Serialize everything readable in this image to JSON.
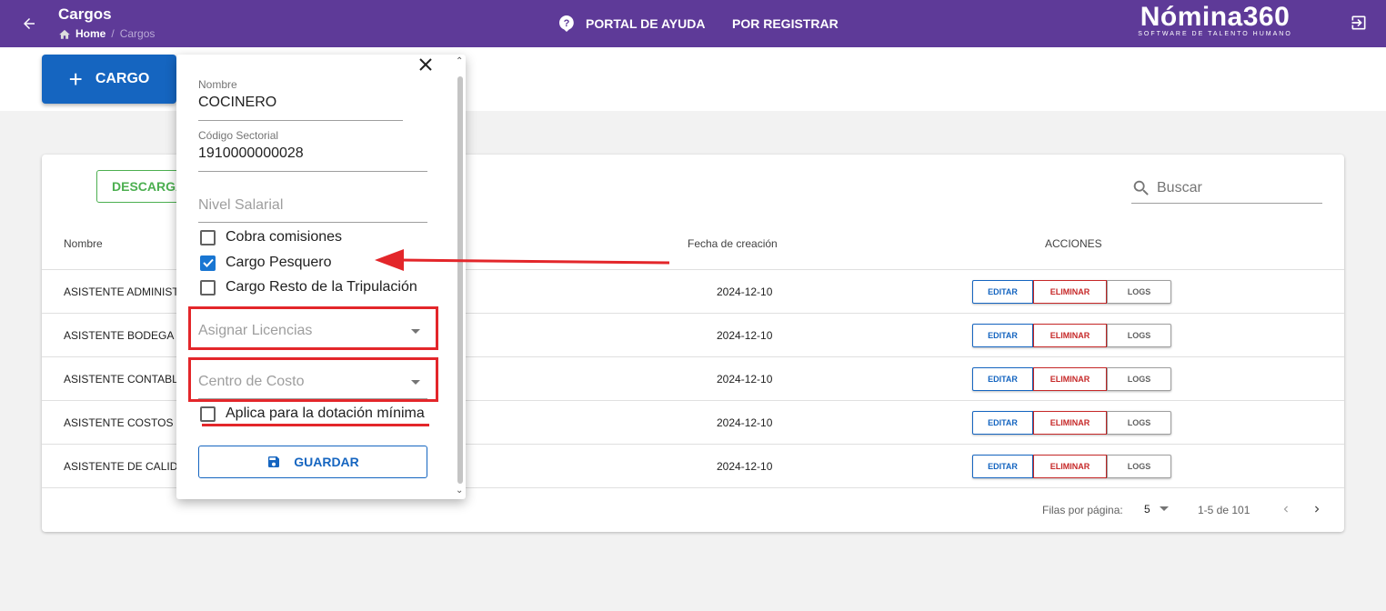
{
  "header": {
    "title": "Cargos",
    "breadcrumb": {
      "home": "Home",
      "current": "Cargos"
    },
    "help_link": "PORTAL DE AYUDA",
    "register_link": "POR REGISTRAR",
    "brand_name": "Nómina360",
    "brand_tagline": "SOFTWARE DE TALENTO HUMANO"
  },
  "toolbar": {
    "add_label": "CARGO"
  },
  "table": {
    "download_label": "DESCARGA",
    "search_placeholder": "Buscar",
    "columns": [
      "Nombre",
      "Fecha de creación",
      "ACCIONES"
    ],
    "action_labels": {
      "edit": "EDITAR",
      "delete": "ELIMINAR",
      "logs": "LOGS"
    },
    "rows": [
      {
        "name": "ASISTENTE ADMINIST",
        "date": "2024-12-10"
      },
      {
        "name": "ASISTENTE BODEGA",
        "date": "2024-12-10"
      },
      {
        "name": "ASISTENTE CONTABL",
        "date": "2024-12-10"
      },
      {
        "name": "ASISTENTE COSTOS",
        "date": "2024-12-10"
      },
      {
        "name": "ASISTENTE DE CALID",
        "date": "2024-12-10"
      }
    ],
    "pagination": {
      "rows_per_page_label": "Filas por página:",
      "rows_per_page": "5",
      "range": "1-5 de 101"
    }
  },
  "dialog": {
    "nombre_label": "Nombre",
    "nombre_value": "COCINERO",
    "codigo_label": "Código Sectorial",
    "codigo_value": "1910000000028",
    "nivel_placeholder": "Nivel Salarial",
    "checkboxes": [
      {
        "label": "Cobra comisiones",
        "checked": false
      },
      {
        "label": "Cargo Pesquero",
        "checked": true
      },
      {
        "label": "Cargo Resto de la Tripulación",
        "checked": false
      }
    ],
    "licencias_placeholder": "Asignar Licencias",
    "centro_placeholder": "Centro de Costo",
    "dotacion_label": "Aplica para la dotación mínima",
    "dotacion_checked": false,
    "save_label": "GUARDAR"
  },
  "colors": {
    "header_bg": "#5e3a98",
    "primary": "#1565c0",
    "success": "#4caf50",
    "danger": "#c62828",
    "annotation": "#e3262a"
  }
}
